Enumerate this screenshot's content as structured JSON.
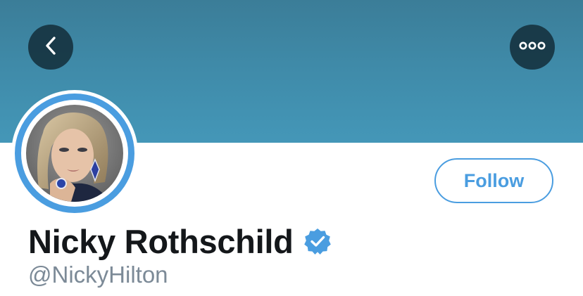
{
  "header": {
    "back_icon": "chevron-left-icon",
    "more_icon": "more-horizontal-icon"
  },
  "profile": {
    "display_name": "Nicky Rothschild",
    "handle": "@NickyHilton",
    "verified": true,
    "verified_icon": "verified-badge-icon",
    "follow_label": "Follow"
  },
  "colors": {
    "banner": "#4093b3",
    "accent": "#4a9de0",
    "name_text": "#14171a",
    "handle_text": "#7c8a97"
  }
}
